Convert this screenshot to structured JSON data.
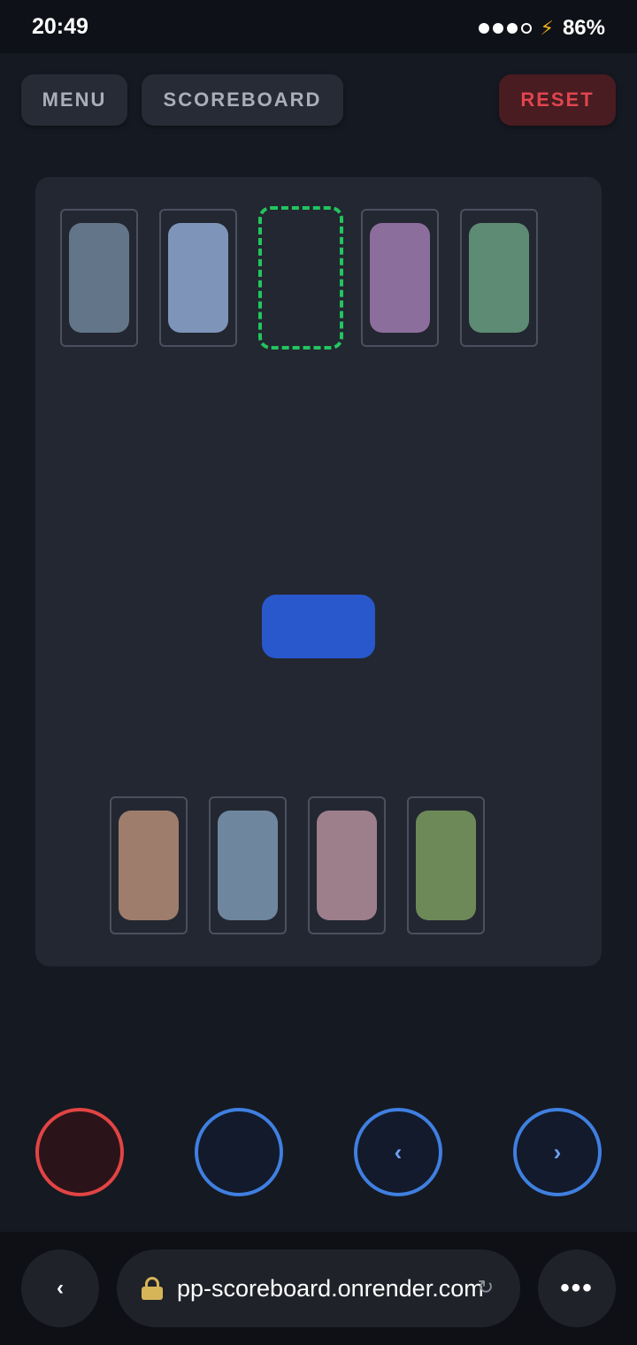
{
  "status_bar": {
    "time": "20:49",
    "battery": "86%",
    "signal_icon": "signal-dots-icon",
    "charging_icon": "lightning-bolt-icon"
  },
  "toolbar": {
    "menu_label": "MENU",
    "scoreboard_label": "SCOREBOARD",
    "reset_label": "RESET"
  },
  "board": {
    "top_row": [
      {
        "color": "#637589"
      },
      {
        "color": "#7f94b9"
      },
      {
        "color": "",
        "target": true
      },
      {
        "color": "#8c6e9d"
      },
      {
        "color": "#5d8b74"
      }
    ],
    "bottom_row": [
      {
        "color": "#9e7d6d"
      },
      {
        "color": "#6f869f"
      },
      {
        "color": "#9d7f8c"
      },
      {
        "color": "#6e8958"
      }
    ],
    "ball_color": "#2858cc",
    "target_color": "#22c55e"
  },
  "controls": {
    "red_button_icon": "empty-circle-icon",
    "blue_button_icon": "empty-circle-icon",
    "prev_label": "‹",
    "next_label": "›"
  },
  "browser": {
    "back_label": "‹",
    "url": "pp-scoreboard.onrender.com",
    "reload_glyph": "↻",
    "more_label": "•••"
  }
}
